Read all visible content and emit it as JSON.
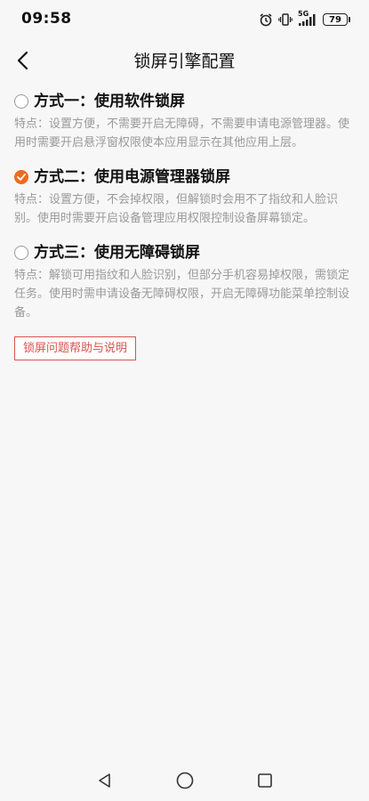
{
  "status_bar": {
    "time": "09:58",
    "network": "5G",
    "battery": "79"
  },
  "header": {
    "title": "锁屏引擎配置"
  },
  "options": [
    {
      "title": "方式一：使用软件锁屏",
      "description": "特点：设置方便，不需要开启无障碍，不需要申请电源管理器。使用时需要开启悬浮窗权限使本应用显示在其他应用上层。",
      "selected": false
    },
    {
      "title": "方式二：使用电源管理器锁屏",
      "description": "特点：设置方便，不会掉权限，但解锁时会用不了指纹和人脸识别。使用时需要开启设备管理应用权限控制设备屏幕锁定。",
      "selected": true
    },
    {
      "title": "方式三：使用无障碍锁屏",
      "description": "特点：解锁可用指纹和人脸识别，但部分手机容易掉权限，需锁定任务。使用时需申请设备无障碍权限，开启无障碍功能菜单控制设备。",
      "selected": false
    }
  ],
  "help_button": {
    "label": "锁屏问题帮助与说明"
  },
  "colors": {
    "accent": "#f06a1c",
    "help_red": "#d9534f",
    "desc_gray": "#9a9a9a",
    "background": "#f7f7f7"
  }
}
